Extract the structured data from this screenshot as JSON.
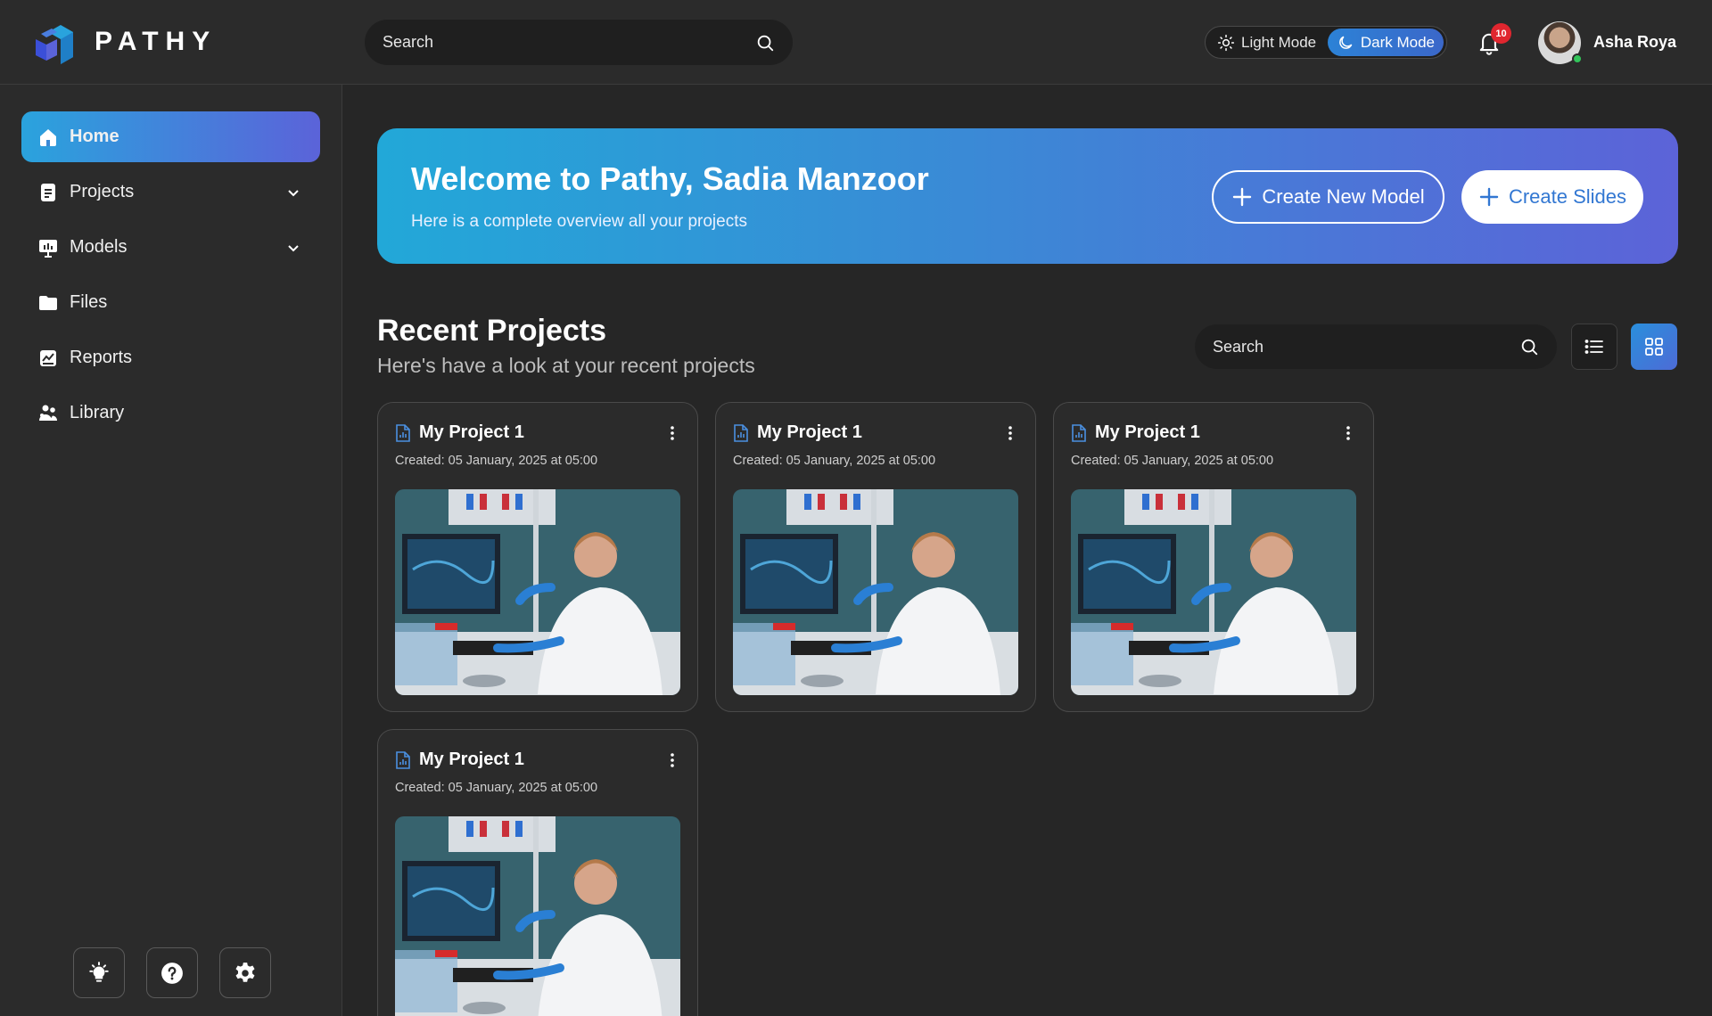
{
  "app": {
    "brand": "PATHY"
  },
  "topbar": {
    "search_placeholder": "Search",
    "mode_light_label": "Light Mode",
    "mode_dark_label": "Dark Mode",
    "active_mode": "dark",
    "notification_count": "10",
    "user_name": "Asha Roya",
    "user_status": "online"
  },
  "sidebar": {
    "items": [
      {
        "label": "Home",
        "icon": "home-icon",
        "active": true
      },
      {
        "label": "Projects",
        "icon": "document-icon",
        "expandable": true
      },
      {
        "label": "Models",
        "icon": "presentation-icon",
        "expandable": true
      },
      {
        "label": "Files",
        "icon": "folder-icon"
      },
      {
        "label": "Reports",
        "icon": "report-icon"
      },
      {
        "label": "Library",
        "icon": "library-icon"
      }
    ],
    "tools": [
      "lightbulb-icon",
      "help-icon",
      "settings-icon"
    ]
  },
  "banner": {
    "title": "Welcome to Pathy, Sadia Manzoor",
    "subtitle": "Here is a complete overview all your projects",
    "create_model_label": "Create New Model",
    "create_slides_label": "Create Slides"
  },
  "recent": {
    "title": "Recent Projects",
    "subtitle": "Here's have a look at your recent projects",
    "search_placeholder": "Search",
    "view_mode": "grid",
    "projects": [
      {
        "title": "My Project 1",
        "created": "Created: 05 January, 2025 at 05:00"
      },
      {
        "title": "My Project 1",
        "created": "Created: 05 January, 2025 at 05:00"
      },
      {
        "title": "My Project 1",
        "created": "Created: 05 January, 2025 at 05:00"
      },
      {
        "title": "My Project 1",
        "created": "Created: 05 January, 2025 at 05:00"
      }
    ]
  },
  "colors": {
    "accent_start": "#2aa3dd",
    "accent_end": "#5b63d9",
    "badge": "#e0262f",
    "online": "#32c45a"
  }
}
